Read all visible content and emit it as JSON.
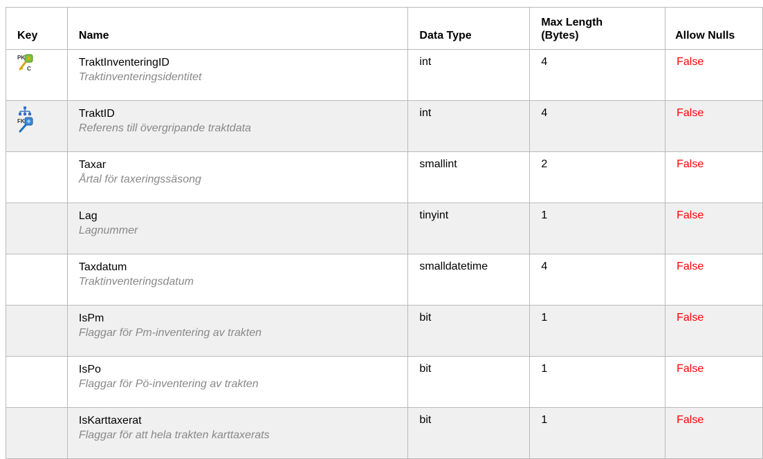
{
  "headers": {
    "key": "Key",
    "name": "Name",
    "data_type": "Data Type",
    "max_length_line1": "Max Length",
    "max_length_line2": "(Bytes)",
    "allow_nulls": "Allow Nulls"
  },
  "rows": [
    {
      "key": "pk-clustered-key-icon",
      "name": "TraktInventeringID",
      "description": "Traktinventeringsidentitet",
      "data_type": "int",
      "max_length": "4",
      "allow_nulls": "False",
      "pk_letters": "PK",
      "c_letter": "C"
    },
    {
      "key": "fk-hierarchy-key-icon",
      "name": "TraktID",
      "description": "Referens till övergripande traktdata",
      "data_type": "int",
      "max_length": "4",
      "allow_nulls": "False",
      "fk_letters": "FK"
    },
    {
      "key": "",
      "name": "Taxar",
      "description": "Årtal för taxeringssäsong",
      "data_type": "smallint",
      "max_length": "2",
      "allow_nulls": "False"
    },
    {
      "key": "",
      "name": "Lag",
      "description": "Lagnummer",
      "data_type": "tinyint",
      "max_length": "1",
      "allow_nulls": "False"
    },
    {
      "key": "",
      "name": "Taxdatum",
      "description": "Traktinventeringsdatum",
      "data_type": "smalldatetime",
      "max_length": "4",
      "allow_nulls": "False"
    },
    {
      "key": "",
      "name": "IsPm",
      "description": "Flaggar för Pm-inventering av trakten",
      "data_type": "bit",
      "max_length": "1",
      "allow_nulls": "False"
    },
    {
      "key": "",
      "name": "IsPo",
      "description": "Flaggar för Pö-inventering av trakten",
      "data_type": "bit",
      "max_length": "1",
      "allow_nulls": "False"
    },
    {
      "key": "",
      "name": "IsKarttaxerat",
      "description": "Flaggar för att hela trakten karttaxerats",
      "data_type": "bit",
      "max_length": "1",
      "allow_nulls": "False"
    }
  ],
  "colors": {
    "null_false": "#ff0000",
    "description": "#888888",
    "row_alt": "#f0f0f0",
    "border": "#b9b9b9"
  }
}
